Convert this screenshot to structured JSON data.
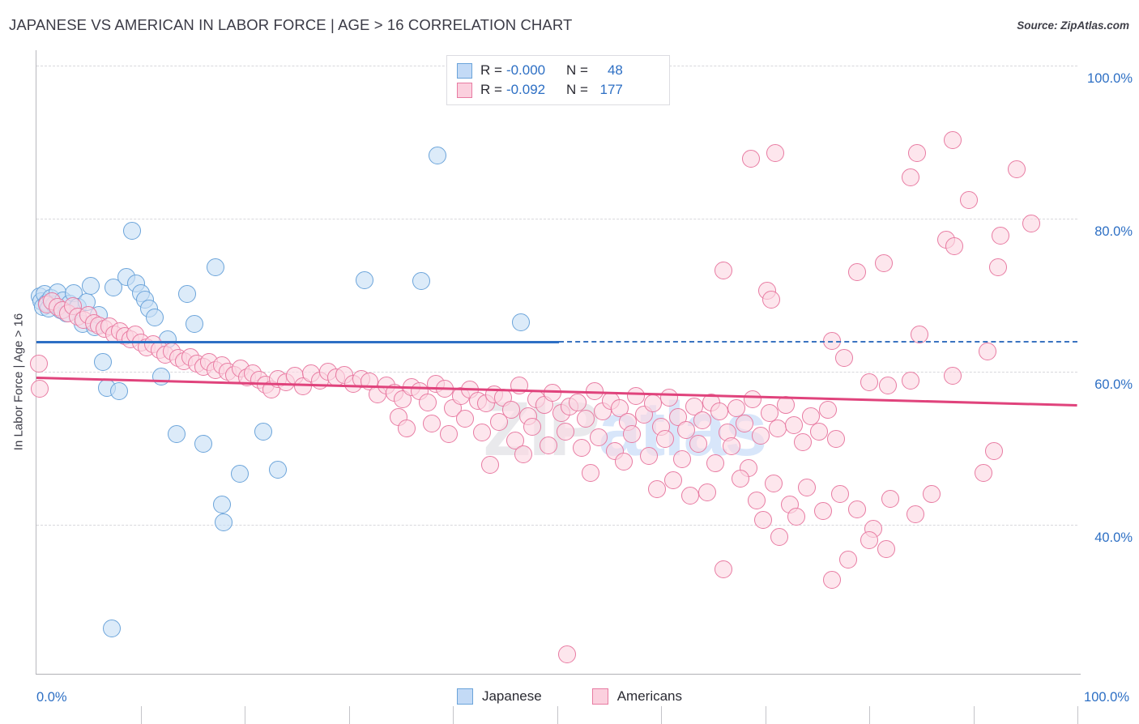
{
  "header": {
    "title": "JAPANESE VS AMERICAN IN LABOR FORCE | AGE > 16 CORRELATION CHART",
    "source": "Source: ZipAtlas.com"
  },
  "watermark": {
    "part1": "ZIP",
    "part2": "atlas"
  },
  "stats": {
    "rows": [
      {
        "series": "Japanese",
        "r_label": "R =",
        "r_value": "-0.000",
        "n_label": "N =",
        "n_value": "48",
        "color": "#c3daf6"
      },
      {
        "series": "Americans",
        "r_label": "R =",
        "r_value": "-0.092",
        "n_label": "N =",
        "n_value": "177",
        "color": "#fbd0de"
      }
    ]
  },
  "legend": {
    "items": [
      {
        "label": "Japanese",
        "color": "#c3daf6",
        "border": "#6ba4da"
      },
      {
        "label": "Americans",
        "color": "#fbd0de",
        "border": "#e87ba2"
      }
    ]
  },
  "chart_data": {
    "type": "scatter",
    "title": "JAPANESE VS AMERICAN IN LABOR FORCE | AGE > 16 CORRELATION CHART",
    "xlabel": "",
    "ylabel": "In Labor Force | Age > 16",
    "xlim": [
      0,
      100
    ],
    "ylim": [
      20.5,
      102
    ],
    "x_ticks": [
      0,
      10,
      20,
      30,
      40,
      50,
      60,
      70,
      80,
      90,
      100
    ],
    "x_tick_labels": [
      "0.0%",
      "100.0%"
    ],
    "y_ticks": [
      40,
      60,
      80,
      100
    ],
    "y_tick_labels": [
      "40.0%",
      "60.0%",
      "80.0%",
      "100.0%"
    ],
    "grid": true,
    "legend_position": "bottom-center",
    "series": [
      {
        "name": "Japanese",
        "color": "#c3daf6",
        "border": "#6ba4da",
        "R": -0.0,
        "N": 48,
        "trendline": {
          "x0": 0,
          "y0": 64.0,
          "x1": 100,
          "y1": 64.0,
          "solid_until_x": 50.2
        },
        "points": [
          [
            0.3,
            69.8
          ],
          [
            0.5,
            69.2
          ],
          [
            0.6,
            68.5
          ],
          [
            0.8,
            70.1
          ],
          [
            1.0,
            69.0
          ],
          [
            1.2,
            68.2
          ],
          [
            1.4,
            69.6
          ],
          [
            1.7,
            68.8
          ],
          [
            2.0,
            70.4
          ],
          [
            2.3,
            68.0
          ],
          [
            2.6,
            69.3
          ],
          [
            2.9,
            67.6
          ],
          [
            3.2,
            68.9
          ],
          [
            3.6,
            70.2
          ],
          [
            4.0,
            68.4
          ],
          [
            4.4,
            66.2
          ],
          [
            4.8,
            69.1
          ],
          [
            5.2,
            71.2
          ],
          [
            5.6,
            65.8
          ],
          [
            6.0,
            67.4
          ],
          [
            6.4,
            61.3
          ],
          [
            6.8,
            57.9
          ],
          [
            7.4,
            71.0
          ],
          [
            7.9,
            57.4
          ],
          [
            8.6,
            72.4
          ],
          [
            9.2,
            78.4
          ],
          [
            9.6,
            71.5
          ],
          [
            10.0,
            70.2
          ],
          [
            10.4,
            69.4
          ],
          [
            10.8,
            68.2
          ],
          [
            11.4,
            67.1
          ],
          [
            12.0,
            59.3
          ],
          [
            12.6,
            64.2
          ],
          [
            13.5,
            51.8
          ],
          [
            14.5,
            70.1
          ],
          [
            15.2,
            66.2
          ],
          [
            16.0,
            50.6
          ],
          [
            17.2,
            73.6
          ],
          [
            17.8,
            42.6
          ],
          [
            18.0,
            40.3
          ],
          [
            19.5,
            46.6
          ],
          [
            21.8,
            52.2
          ],
          [
            23.2,
            47.2
          ],
          [
            31.5,
            71.9
          ],
          [
            38.5,
            88.2
          ],
          [
            37.0,
            71.8
          ],
          [
            46.5,
            66.4
          ],
          [
            7.2,
            26.4
          ]
        ]
      },
      {
        "name": "Americans",
        "color": "#fbd0de",
        "border": "#e87ba2",
        "R": -0.092,
        "N": 177,
        "trendline": {
          "x0": 0,
          "y0": 59.3,
          "x1": 100,
          "y1": 55.7
        },
        "points": [
          [
            0.2,
            61.0
          ],
          [
            0.3,
            57.8
          ],
          [
            1.0,
            68.8
          ],
          [
            1.5,
            69.2
          ],
          [
            2.0,
            68.4
          ],
          [
            2.5,
            68.0
          ],
          [
            3.0,
            67.6
          ],
          [
            3.5,
            68.6
          ],
          [
            4.0,
            67.2
          ],
          [
            4.5,
            66.8
          ],
          [
            5.0,
            67.4
          ],
          [
            5.5,
            66.3
          ],
          [
            6.0,
            66.0
          ],
          [
            6.5,
            65.6
          ],
          [
            7.0,
            65.9
          ],
          [
            7.5,
            64.9
          ],
          [
            8.0,
            65.3
          ],
          [
            8.5,
            64.6
          ],
          [
            9.0,
            64.2
          ],
          [
            9.5,
            64.8
          ],
          [
            10.0,
            63.8
          ],
          [
            10.6,
            63.2
          ],
          [
            11.2,
            63.6
          ],
          [
            11.8,
            62.8
          ],
          [
            12.4,
            62.2
          ],
          [
            13.0,
            62.6
          ],
          [
            13.6,
            61.8
          ],
          [
            14.2,
            61.4
          ],
          [
            14.8,
            61.9
          ],
          [
            15.4,
            61.0
          ],
          [
            16.0,
            60.6
          ],
          [
            16.6,
            61.2
          ],
          [
            17.2,
            60.2
          ],
          [
            17.8,
            60.8
          ],
          [
            18.4,
            60.0
          ],
          [
            19.0,
            59.6
          ],
          [
            19.6,
            60.4
          ],
          [
            20.2,
            59.2
          ],
          [
            20.8,
            59.8
          ],
          [
            21.4,
            58.9
          ],
          [
            22.0,
            58.3
          ],
          [
            22.6,
            57.6
          ],
          [
            23.2,
            59.0
          ],
          [
            24.0,
            58.6
          ],
          [
            24.8,
            59.4
          ],
          [
            25.6,
            58.1
          ],
          [
            26.4,
            59.8
          ],
          [
            27.2,
            58.8
          ],
          [
            28.0,
            60.0
          ],
          [
            28.8,
            59.2
          ],
          [
            29.6,
            59.6
          ],
          [
            30.4,
            58.4
          ],
          [
            31.2,
            59.0
          ],
          [
            32.0,
            58.7
          ],
          [
            32.8,
            57.0
          ],
          [
            33.6,
            58.2
          ],
          [
            34.4,
            57.2
          ],
          [
            35.2,
            56.4
          ],
          [
            36.0,
            58.0
          ],
          [
            36.8,
            57.4
          ],
          [
            37.6,
            56.0
          ],
          [
            38.4,
            58.4
          ],
          [
            39.2,
            57.8
          ],
          [
            40.0,
            55.2
          ],
          [
            40.8,
            56.8
          ],
          [
            41.6,
            57.6
          ],
          [
            42.4,
            56.2
          ],
          [
            43.2,
            55.8
          ],
          [
            44.0,
            57.0
          ],
          [
            44.8,
            56.6
          ],
          [
            45.6,
            55.0
          ],
          [
            46.4,
            58.2
          ],
          [
            47.2,
            54.2
          ],
          [
            48.0,
            56.4
          ],
          [
            48.8,
            55.6
          ],
          [
            49.6,
            57.2
          ],
          [
            50.4,
            54.6
          ],
          [
            51.2,
            55.4
          ],
          [
            52.0,
            56.0
          ],
          [
            52.8,
            53.8
          ],
          [
            53.6,
            57.4
          ],
          [
            54.4,
            54.8
          ],
          [
            55.2,
            56.2
          ],
          [
            56.0,
            55.2
          ],
          [
            56.8,
            53.4
          ],
          [
            57.6,
            56.8
          ],
          [
            58.4,
            54.4
          ],
          [
            59.2,
            55.8
          ],
          [
            60.0,
            52.8
          ],
          [
            60.8,
            56.6
          ],
          [
            61.6,
            54.0
          ],
          [
            62.4,
            52.4
          ],
          [
            63.2,
            55.4
          ],
          [
            64.0,
            53.6
          ],
          [
            64.8,
            56.0
          ],
          [
            65.6,
            54.8
          ],
          [
            66.4,
            52.0
          ],
          [
            67.2,
            55.2
          ],
          [
            68.0,
            53.2
          ],
          [
            68.8,
            56.4
          ],
          [
            69.6,
            51.6
          ],
          [
            70.4,
            54.6
          ],
          [
            71.2,
            52.6
          ],
          [
            72.0,
            55.6
          ],
          [
            72.8,
            53.0
          ],
          [
            73.6,
            50.8
          ],
          [
            74.4,
            54.2
          ],
          [
            75.2,
            52.2
          ],
          [
            76.0,
            55.0
          ],
          [
            76.8,
            51.2
          ],
          [
            34.8,
            54.0
          ],
          [
            35.6,
            52.6
          ],
          [
            38.0,
            53.2
          ],
          [
            39.6,
            51.8
          ],
          [
            41.2,
            53.8
          ],
          [
            42.8,
            52.0
          ],
          [
            44.4,
            53.4
          ],
          [
            46.0,
            51.0
          ],
          [
            47.6,
            52.8
          ],
          [
            49.2,
            50.4
          ],
          [
            50.8,
            52.2
          ],
          [
            52.4,
            50.0
          ],
          [
            54.0,
            51.4
          ],
          [
            55.6,
            49.6
          ],
          [
            57.2,
            51.8
          ],
          [
            58.8,
            49.0
          ],
          [
            60.4,
            51.2
          ],
          [
            62.0,
            48.6
          ],
          [
            63.6,
            50.6
          ],
          [
            65.2,
            48.0
          ],
          [
            66.8,
            50.2
          ],
          [
            68.4,
            47.4
          ],
          [
            43.6,
            47.8
          ],
          [
            46.8,
            49.2
          ],
          [
            53.2,
            46.8
          ],
          [
            56.4,
            48.2
          ],
          [
            59.6,
            44.6
          ],
          [
            61.2,
            45.8
          ],
          [
            62.8,
            43.8
          ],
          [
            64.4,
            44.2
          ],
          [
            67.6,
            46.0
          ],
          [
            69.2,
            43.2
          ],
          [
            70.8,
            45.4
          ],
          [
            72.4,
            42.6
          ],
          [
            74.0,
            44.8
          ],
          [
            75.6,
            41.8
          ],
          [
            77.2,
            44.0
          ],
          [
            78.8,
            42.0
          ],
          [
            80.4,
            39.4
          ],
          [
            82.0,
            43.4
          ],
          [
            69.8,
            40.6
          ],
          [
            71.4,
            38.4
          ],
          [
            73.0,
            41.0
          ],
          [
            78.0,
            35.4
          ],
          [
            80.0,
            38.0
          ],
          [
            66.0,
            34.2
          ],
          [
            76.4,
            32.8
          ],
          [
            81.6,
            36.8
          ],
          [
            84.4,
            41.4
          ],
          [
            86.0,
            44.0
          ],
          [
            68.6,
            87.8
          ],
          [
            71.0,
            88.6
          ],
          [
            66.0,
            73.2
          ],
          [
            84.6,
            88.6
          ],
          [
            84.0,
            85.4
          ],
          [
            88.0,
            90.2
          ],
          [
            89.6,
            82.4
          ],
          [
            87.4,
            77.2
          ],
          [
            88.2,
            76.4
          ],
          [
            92.6,
            77.8
          ],
          [
            95.6,
            79.4
          ],
          [
            94.2,
            86.4
          ],
          [
            92.4,
            73.6
          ],
          [
            78.8,
            73.0
          ],
          [
            81.4,
            74.2
          ],
          [
            70.2,
            70.6
          ],
          [
            70.6,
            69.4
          ],
          [
            76.4,
            64.0
          ],
          [
            77.6,
            61.8
          ],
          [
            84.8,
            64.8
          ],
          [
            88.0,
            59.4
          ],
          [
            91.4,
            62.6
          ],
          [
            80.0,
            58.6
          ],
          [
            81.8,
            58.2
          ],
          [
            84.0,
            58.8
          ],
          [
            92.0,
            49.6
          ],
          [
            91.0,
            46.8
          ],
          [
            51.0,
            23.0
          ]
        ]
      }
    ]
  }
}
